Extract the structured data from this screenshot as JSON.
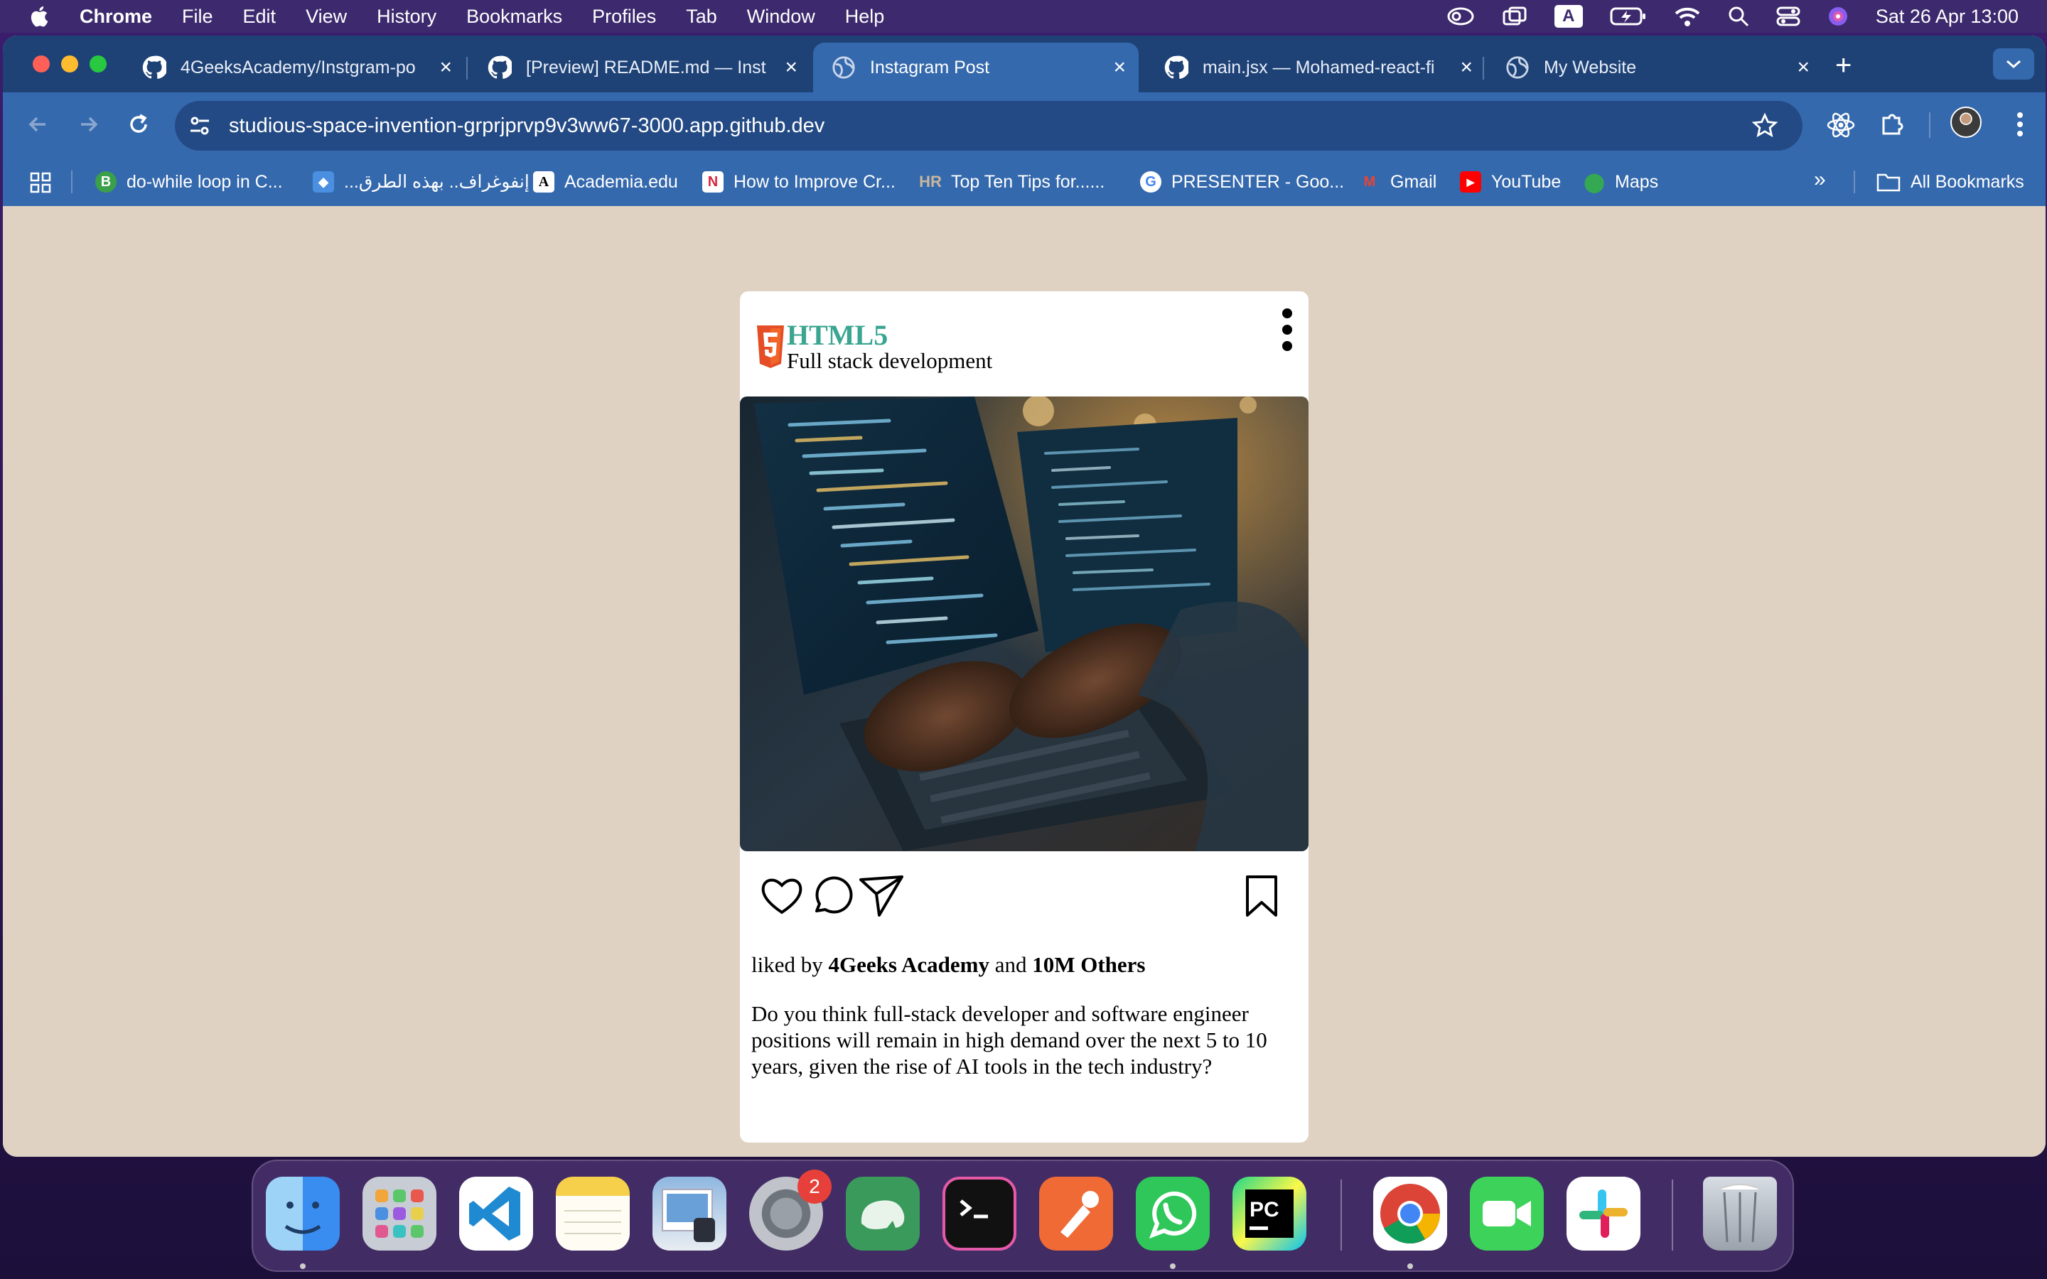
{
  "menubar": {
    "app": "Chrome",
    "items": [
      "File",
      "Edit",
      "View",
      "History",
      "Bookmarks",
      "Profiles",
      "Tab",
      "Window",
      "Help"
    ],
    "input_badge": "A",
    "clock": "Sat 26 Apr  13:00"
  },
  "tabs": [
    {
      "title": "4GeeksAcademy/Instgram-po",
      "icon": "github-icon",
      "active": false
    },
    {
      "title": "[Preview] README.md — Inst",
      "icon": "github-icon",
      "active": false
    },
    {
      "title": "Instagram Post",
      "icon": "globe-icon",
      "active": true
    },
    {
      "title": "main.jsx — Mohamed-react-fi",
      "icon": "github-icon",
      "active": false
    },
    {
      "title": "My Website",
      "icon": "globe-icon",
      "active": false
    }
  ],
  "address_bar": {
    "url": "studious-space-invention-grprjprvp9v3ww67-3000.app.github.dev"
  },
  "bookmarks": [
    {
      "label": "do-while loop in C...",
      "icon": "b-icon"
    },
    {
      "label": "إنفوغراف.. بهذه الطرق...",
      "icon": "diamond-icon"
    },
    {
      "label": "Academia.edu",
      "icon": "academia-icon"
    },
    {
      "label": "How to Improve Cr...",
      "icon": "n-icon"
    },
    {
      "label": "Top Ten Tips for......",
      "icon": "hr-icon"
    },
    {
      "label": "PRESENTER - Goo...",
      "icon": "google-icon"
    },
    {
      "label": "Gmail",
      "icon": "gmail-icon"
    },
    {
      "label": "YouTube",
      "icon": "youtube-icon"
    },
    {
      "label": "Maps",
      "icon": "maps-icon"
    }
  ],
  "all_bookmarks": "All Bookmarks",
  "post": {
    "title": "HTML5",
    "subtitle": "Full stack development",
    "likes_prefix": "liked by ",
    "likes_user": "4Geeks Academy",
    "likes_and": " and ",
    "likes_others": "10M Others",
    "caption": "Do you think full-stack developer and software engineer positions will remain in high demand over the next 5 to 10 years, given the rise of AI tools in the tech industry?"
  },
  "dock": {
    "settings_badge": "2",
    "apps": [
      "finder-icon",
      "launchpad-icon",
      "vscode-icon",
      "notes-icon",
      "preview-icon",
      "system-settings-icon",
      "dbngin-icon",
      "terminal-icon",
      "postman-icon",
      "whatsapp-icon",
      "pycharm-icon",
      "chrome-icon",
      "facetime-icon",
      "slack-icon",
      "trash-icon"
    ]
  },
  "colors": {
    "page_bg": "#e0d2c3",
    "tabstrip": "#1f4276",
    "toolbar": "#3569ad",
    "html5_title": "#3aa591",
    "html5_logo": "#e44d26"
  }
}
